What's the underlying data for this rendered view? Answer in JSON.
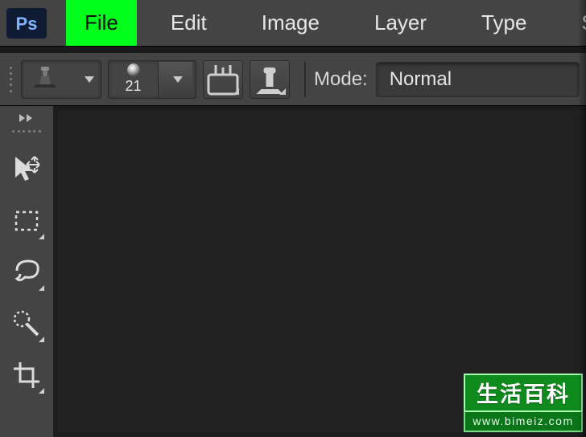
{
  "app": {
    "logo_text": "Ps"
  },
  "menu": [
    {
      "label": "File",
      "highlight": true
    },
    {
      "label": "Edit"
    },
    {
      "label": "Image"
    },
    {
      "label": "Layer"
    },
    {
      "label": "Type"
    },
    {
      "label": "Select"
    }
  ],
  "options": {
    "brush_size": "21",
    "mode_label": "Mode:",
    "mode_value": "Normal"
  },
  "tools": [
    {
      "name": "move-tool"
    },
    {
      "name": "rectangular-marquee-tool"
    },
    {
      "name": "lasso-tool"
    },
    {
      "name": "quick-selection-tool"
    },
    {
      "name": "crop-tool"
    }
  ],
  "watermark": {
    "top": "生活百科",
    "bottom": "www.bimeiz.com"
  }
}
